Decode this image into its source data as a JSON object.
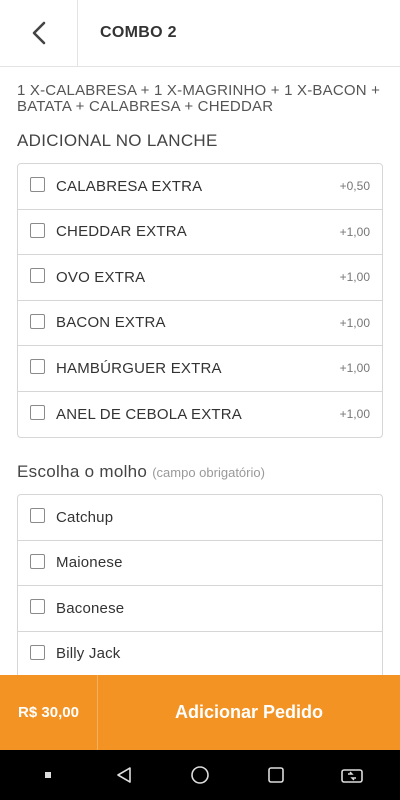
{
  "header": {
    "title": "COMBO 2",
    "back_icon": "chevron-left-icon"
  },
  "product": {
    "description": "1 X-CALABRESA + 1 X-MAGRINHO + 1 X-BACON + BATATA + CALABRESA + CHEDDAR"
  },
  "addons": {
    "title": "ADICIONAL NO LANCHE",
    "items": [
      {
        "label": "CALABRESA EXTRA",
        "price": "+0,50"
      },
      {
        "label": "CHEDDAR EXTRA",
        "price": "+1,00"
      },
      {
        "label": "OVO EXTRA",
        "price": "+1,00"
      },
      {
        "label": "BACON EXTRA",
        "price": "+1,00"
      },
      {
        "label": "HAMBÚRGUER EXTRA",
        "price": "+1,00"
      },
      {
        "label": "ANEL DE CEBOLA EXTRA",
        "price": "+1,00"
      }
    ]
  },
  "sauce": {
    "title": "Escolha o molho",
    "hint": "(campo obrigatório)",
    "items": [
      {
        "label": "Catchup"
      },
      {
        "label": "Maionese"
      },
      {
        "label": "Baconese"
      },
      {
        "label": "Billy Jack"
      }
    ]
  },
  "footer": {
    "total": "R$ 30,00",
    "add_label": "Adicionar Pedido"
  },
  "colors": {
    "accent": "#f39323",
    "navbar": "#000000"
  }
}
